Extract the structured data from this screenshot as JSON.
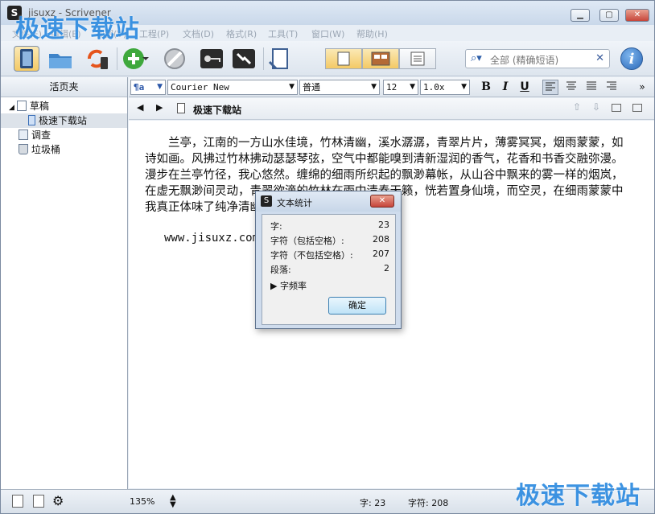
{
  "window": {
    "title": "jisuxz - Scrivener",
    "watermark": "极速下载站"
  },
  "menu": [
    "文件(F)",
    "编辑(E)",
    "视图(V)",
    "工程(P)",
    "文档(D)",
    "格式(R)",
    "工具(T)",
    "窗口(W)",
    "帮助(H)"
  ],
  "search": {
    "placeholder": "全部 (精确短语)"
  },
  "binder": {
    "header": "活页夹",
    "items": [
      {
        "label": "草稿"
      },
      {
        "label": "极速下载站"
      },
      {
        "label": "调查"
      },
      {
        "label": "垃圾桶"
      }
    ]
  },
  "format": {
    "style_icon": "¶a",
    "font": "Courier New",
    "weight": "普通",
    "size": "12",
    "spacing": "1.0x"
  },
  "header": {
    "doc_title": "极速下载站"
  },
  "editor": {
    "paragraph": "兰亭，江南的一方山水佳境，竹林清幽，溪水潺潺，青翠片片，薄雾冥冥，烟雨蒙蒙，如诗如画。风拂过竹林拂动瑟瑟琴弦，空气中都能嗅到清新湿润的香气，花香和书香交融弥漫。漫步在兰亭竹径，我心悠然。缠绵的细雨所织起的飘渺幕帐，从山谷中飘来的雾一样的烟岚，在虚无飘渺间灵动，青翠欲滴的竹林在雨中清奏天籁，恍若置身仙境，而空灵，在细雨蒙蒙中我真正体味了纯净清幽的兰亭雨榭。",
    "url": "www.jisuxz.com"
  },
  "dialog": {
    "title": "文本统计",
    "rows": [
      {
        "label": "字:",
        "value": "23"
      },
      {
        "label": "字符（包括空格）:",
        "value": "208"
      },
      {
        "label": "字符（不包括空格）:",
        "value": "207"
      },
      {
        "label": "段落:",
        "value": "2"
      }
    ],
    "freq_label": "字频率",
    "ok_label": "确定"
  },
  "status": {
    "zoom": "135%",
    "words": "字: 23",
    "chars": "字符: 208"
  }
}
